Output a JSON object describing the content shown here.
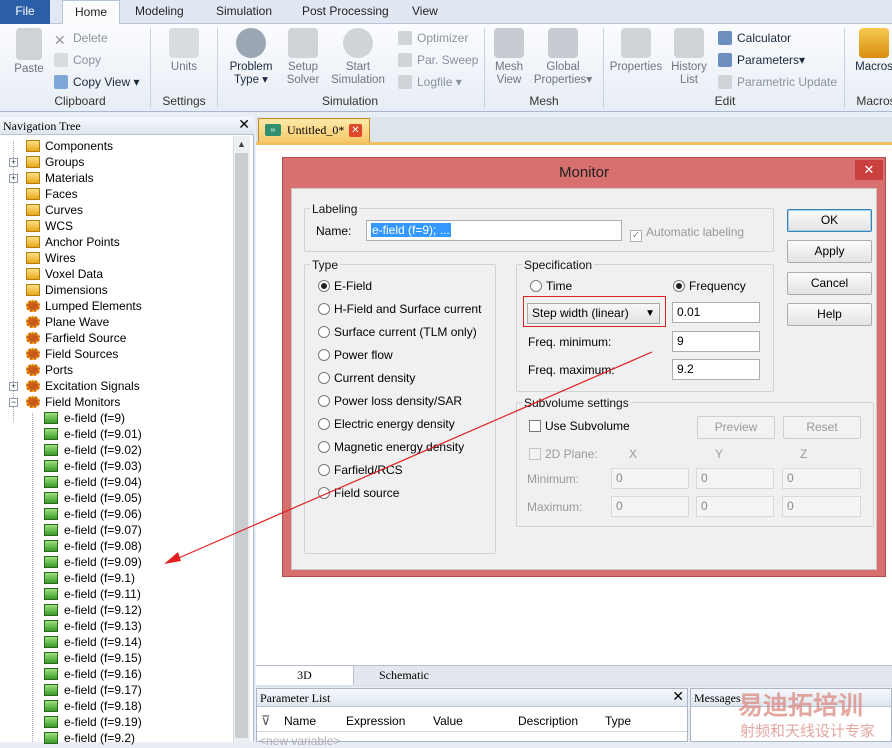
{
  "ribbon": {
    "tabs": [
      "File",
      "Home",
      "Modeling",
      "Simulation",
      "Post Processing",
      "View"
    ],
    "clipboard": {
      "paste": "Paste",
      "delete": "Delete",
      "copy": "Copy",
      "copy_view": "Copy View",
      "group": "Clipboard"
    },
    "settings": {
      "units": "Units",
      "group": "Settings"
    },
    "simulation": {
      "problem_type": "Problem Type",
      "setup_solver": "Setup Solver",
      "start_simulation": "Start Simulation",
      "optimizer": "Optimizer",
      "par_sweep": "Par. Sweep",
      "logfile": "Logfile",
      "group": "Simulation"
    },
    "mesh": {
      "mesh_view": "Mesh View",
      "global_properties": "Global Properties",
      "group": "Mesh"
    },
    "edit": {
      "properties": "Properties",
      "history_list": "History List",
      "calculator": "Calculator",
      "parameters": "Parameters",
      "parametric_update": "Parametric Update",
      "group": "Edit"
    },
    "macros": {
      "macros": "Macros",
      "group": "Macros"
    }
  },
  "nav": {
    "title": "Navigation Tree",
    "items": [
      {
        "label": "Components",
        "icon": "folder-icon",
        "expand": false
      },
      {
        "label": "Groups",
        "icon": "folder-icon",
        "expand": true
      },
      {
        "label": "Materials",
        "icon": "folder-icon",
        "expand": true
      },
      {
        "label": "Faces",
        "icon": "folder-icon",
        "expand": false
      },
      {
        "label": "Curves",
        "icon": "folder-icon",
        "expand": false
      },
      {
        "label": "WCS",
        "icon": "folder-icon",
        "expand": false
      },
      {
        "label": "Anchor Points",
        "icon": "folder-icon",
        "expand": false
      },
      {
        "label": "Wires",
        "icon": "folder-icon",
        "expand": false
      },
      {
        "label": "Voxel Data",
        "icon": "folder-icon",
        "expand": false
      },
      {
        "label": "Dimensions",
        "icon": "folder-icon",
        "expand": false
      },
      {
        "label": "Lumped Elements",
        "icon": "gear-icon",
        "expand": false
      },
      {
        "label": "Plane Wave",
        "icon": "gear-icon",
        "expand": false
      },
      {
        "label": "Farfield Source",
        "icon": "gear-icon",
        "expand": false
      },
      {
        "label": "Field Sources",
        "icon": "gear-icon",
        "expand": false
      },
      {
        "label": "Ports",
        "icon": "gear-icon",
        "expand": false
      },
      {
        "label": "Excitation Signals",
        "icon": "gear-icon",
        "expand": true
      },
      {
        "label": "Field Monitors",
        "icon": "gear-icon",
        "expand": true
      }
    ],
    "monitors": [
      "e-field (f=9)",
      "e-field (f=9.01)",
      "e-field (f=9.02)",
      "e-field (f=9.03)",
      "e-field (f=9.04)",
      "e-field (f=9.05)",
      "e-field (f=9.06)",
      "e-field (f=9.07)",
      "e-field (f=9.08)",
      "e-field (f=9.09)",
      "e-field (f=9.1)",
      "e-field (f=9.11)",
      "e-field (f=9.12)",
      "e-field (f=9.13)",
      "e-field (f=9.14)",
      "e-field (f=9.15)",
      "e-field (f=9.16)",
      "e-field (f=9.17)",
      "e-field (f=9.18)",
      "e-field (f=9.19)",
      "e-field (f=9.2)"
    ]
  },
  "doc": {
    "tab": "Untitled_0*",
    "view_3d": "3D",
    "view_schematic": "Schematic"
  },
  "param_list": {
    "title": "Parameter List",
    "columns": [
      "Name",
      "Expression",
      "Value",
      "Description",
      "Type"
    ],
    "new_variable": "<new variable>"
  },
  "messages": {
    "title": "Messages"
  },
  "dialog": {
    "title": "Monitor",
    "labeling": {
      "group": "Labeling",
      "name_label": "Name:",
      "name_value": "e-field (f=9); ...",
      "auto_label": "Automatic labeling"
    },
    "type": {
      "group": "Type",
      "options": [
        "E-Field",
        "H-Field and Surface current",
        "Surface current (TLM only)",
        "Power flow",
        "Current density",
        "Power loss density/SAR",
        "Electric energy density",
        "Magnetic energy density",
        "Farfield/RCS",
        "Field source"
      ],
      "selected": 0
    },
    "spec": {
      "group": "Specification",
      "time": "Time",
      "frequency": "Frequency",
      "step_mode": "Step width (linear)",
      "step_value": "0.01",
      "fmin_label": "Freq. minimum:",
      "fmin": "9",
      "fmax_label": "Freq. maximum:",
      "fmax": "9.2"
    },
    "subvolume": {
      "group": "Subvolume settings",
      "use": "Use Subvolume",
      "preview": "Preview",
      "reset": "Reset",
      "plane": "2D Plane:",
      "x": "X",
      "y": "Y",
      "z": "Z",
      "min_label": "Minimum:",
      "max_label": "Maximum:",
      "min": [
        "0",
        "0",
        "0"
      ],
      "max": [
        "0",
        "0",
        "0"
      ]
    },
    "buttons": {
      "ok": "OK",
      "apply": "Apply",
      "cancel": "Cancel",
      "help": "Help"
    }
  },
  "watermark": {
    "line1": "易迪拓培训",
    "line2": "射频和天线设计专家"
  },
  "colors": {
    "highlight": "#e02020",
    "accent": "#2a5ea8"
  }
}
